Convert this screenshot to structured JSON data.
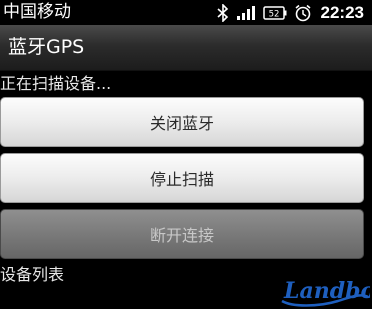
{
  "status_bar": {
    "carrier": "中国移动",
    "battery": "52",
    "time": "22:23",
    "icons": [
      "bluetooth-icon",
      "signal-icon",
      "battery-icon",
      "alarm-icon"
    ]
  },
  "title_bar": {
    "title": "蓝牙GPS"
  },
  "scan_status": "正在扫描设备...",
  "buttons": {
    "close_bluetooth": "关闭蓝牙",
    "stop_scan": "停止扫描",
    "disconnect": "断开连接"
  },
  "device_list_label": "设备列表",
  "colors": {
    "background": "#000000",
    "button_enabled": "#e6e6e6",
    "button_disabled": "#777777",
    "watermark_blue": "#1e5fbf"
  }
}
